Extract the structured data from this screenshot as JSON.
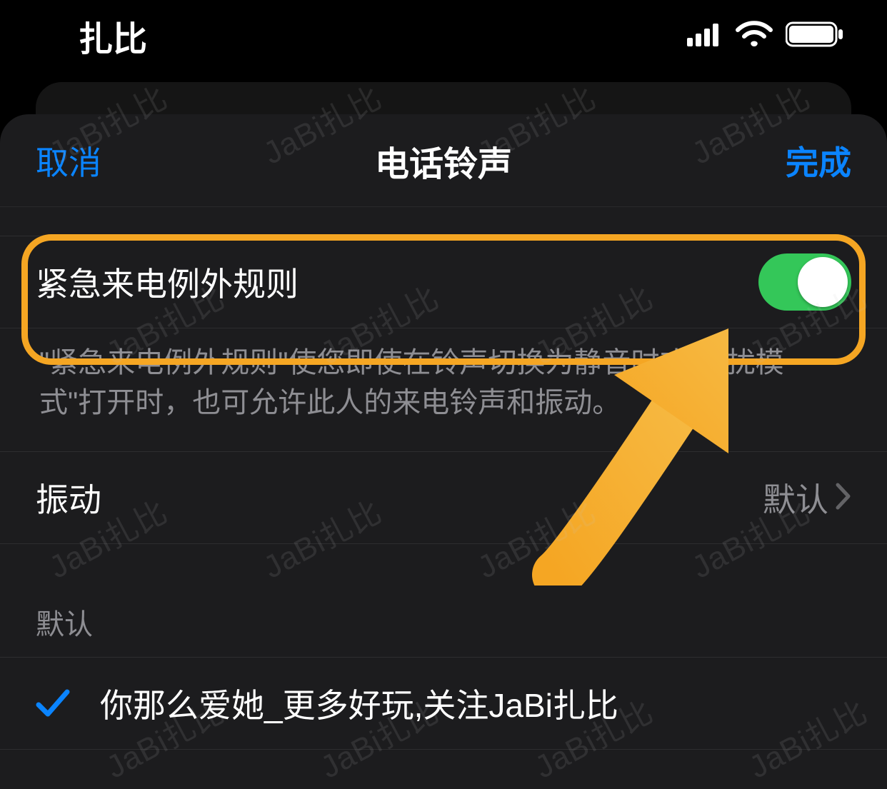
{
  "status": {
    "title": "扎比"
  },
  "nav": {
    "cancel": "取消",
    "title": "电话铃声",
    "done": "完成"
  },
  "emergency": {
    "label": "紧急来电例外规则",
    "note": "\"紧急来电例外规则\"使您即使在铃声切换为静音时或\"勿扰模式\"打开时，也可允许此人的来电铃声和振动。",
    "on": true
  },
  "vibration": {
    "label": "振动",
    "value": "默认"
  },
  "default_section": {
    "header": "默认",
    "items": [
      {
        "label": "你那么爱她_更多好玩,关注JaBi扎比",
        "selected": true
      }
    ]
  },
  "watermark_text": "JaBi扎比"
}
